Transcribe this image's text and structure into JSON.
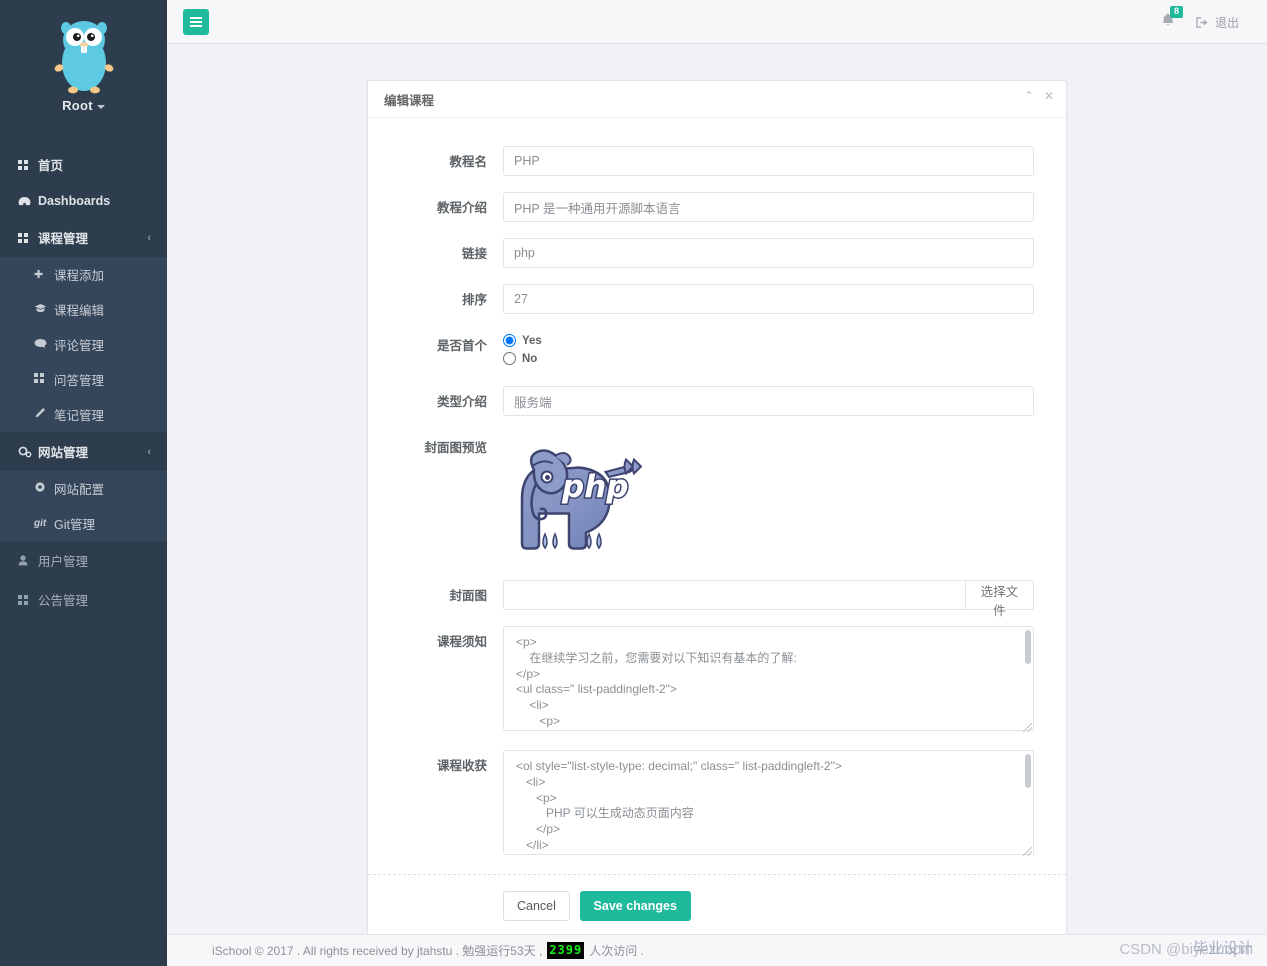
{
  "sidebar": {
    "profile": {
      "name": "Root",
      "avatar_icon": "go-gopher-logo"
    },
    "items": [
      {
        "label": "首页",
        "icon": "grid-icon",
        "type": "nav"
      },
      {
        "label": "Dashboards",
        "icon": "dashboard-icon",
        "type": "nav"
      },
      {
        "label": "课程管理",
        "icon": "grid-icon",
        "type": "nav",
        "arrow": "‹"
      },
      {
        "label": "课程添加",
        "icon": "plus-icon",
        "type": "sub"
      },
      {
        "label": "课程编辑",
        "icon": "graduation-cap-icon",
        "type": "sub"
      },
      {
        "label": "评论管理",
        "icon": "comment-icon",
        "type": "sub"
      },
      {
        "label": "问答管理",
        "icon": "grid-icon",
        "type": "sub"
      },
      {
        "label": "笔记管理",
        "icon": "pencil-icon",
        "type": "sub"
      },
      {
        "label": "网站管理",
        "icon": "gears-icon",
        "type": "nav",
        "arrow": "‹"
      },
      {
        "label": "网站配置",
        "icon": "gear-icon",
        "type": "sub"
      },
      {
        "label": "Git管理",
        "icon": "git-icon",
        "type": "sub"
      },
      {
        "label": "用户管理",
        "icon": "user-icon",
        "type": "nav"
      },
      {
        "label": "公告管理",
        "icon": "grid-icon",
        "type": "nav"
      }
    ]
  },
  "topbar": {
    "menu_toggle_icon": "hamburger-icon",
    "bell_icon": "bell-icon",
    "notification_count": "8",
    "logout_icon": "sign-out-icon",
    "logout_label": "退出"
  },
  "panel": {
    "title": "编辑课程",
    "collapse_icon": "chevron-up-icon",
    "close_icon": "close-icon",
    "fields": [
      {
        "label": "教程名",
        "value": "PHP"
      },
      {
        "label": "教程介绍",
        "value": "PHP 是一种通用开源脚本语言"
      },
      {
        "label": "链接",
        "value": "php"
      },
      {
        "label": "排序",
        "value": "27"
      }
    ],
    "first_flag": {
      "label": "是否首个",
      "options": [
        {
          "label": "Yes",
          "checked": true
        },
        {
          "label": "No",
          "checked": false
        }
      ]
    },
    "type_intro": {
      "label": "类型介绍",
      "value": "服务端"
    },
    "cover_preview": {
      "label": "封面图预览",
      "image": "php-elephant-logo"
    },
    "cover_upload": {
      "label": "封面图",
      "value": "",
      "button": "选择文件"
    },
    "notice": {
      "label": "课程须知",
      "value": "<p>\n    在继续学习之前，您需要对以下知识有基本的了解:\n</p>\n<ul class=\" list-paddingleft-2\">\n    <li>\n       <p>\n          HTML"
    },
    "gains": {
      "label": "课程收获",
      "value": "<ol style=\"list-style-type: decimal;\" class=\" list-paddingleft-2\">\n   <li>\n      <p>\n         PHP 可以生成动态页面内容\n      </p>\n   </li>\n   <li>"
    },
    "cancel_label": "Cancel",
    "save_label": "Save changes"
  },
  "footer": {
    "text_before": "iSchool © 2017 . All rights received by jtahstu . 勉强运行53天 ,",
    "counter": "2399",
    "text_after": "人次访问 .",
    "watermark": "CSDN @biyezuopin",
    "watermark_overlay": "毕业设计"
  },
  "colors": {
    "sidebar": "#2e3d4d",
    "sidebar_sub": "#35465a",
    "accent": "#1fb99b",
    "page_bg": "#f1f2f7",
    "counter_green": "#14f014"
  }
}
